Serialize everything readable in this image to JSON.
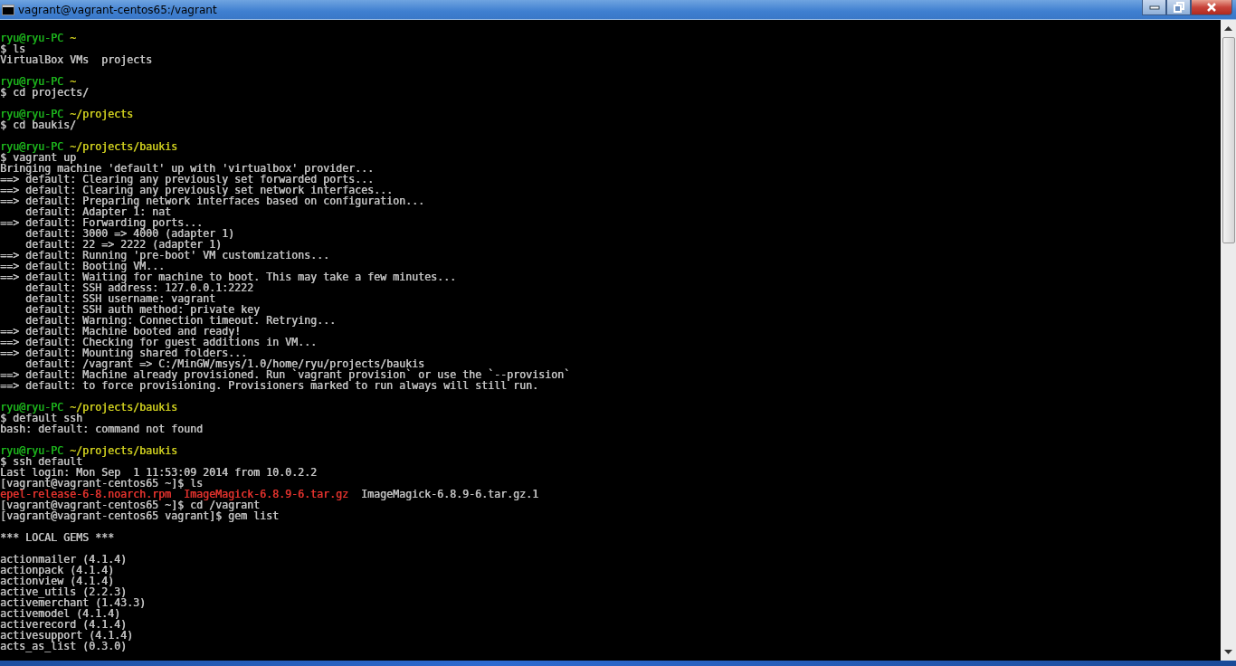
{
  "window": {
    "title": "vagrant@vagrant-centos65:/vagrant"
  },
  "terminal": {
    "lines": [
      {
        "kind": "blank"
      },
      {
        "kind": "text",
        "segments": [
          {
            "text": "ryu@ryu-PC",
            "color": "#1cb01c"
          },
          {
            "text": " ~",
            "color": "#c8c81e"
          }
        ]
      },
      {
        "kind": "text",
        "segments": [
          {
            "text": "$ ls",
            "color": "#c0c0c0"
          }
        ]
      },
      {
        "kind": "text",
        "segments": [
          {
            "text": "VirtualBox VMs  projects",
            "color": "#c0c0c0"
          }
        ]
      },
      {
        "kind": "blank"
      },
      {
        "kind": "text",
        "segments": [
          {
            "text": "ryu@ryu-PC",
            "color": "#1cb01c"
          },
          {
            "text": " ~",
            "color": "#c8c81e"
          }
        ]
      },
      {
        "kind": "text",
        "segments": [
          {
            "text": "$ cd projects/",
            "color": "#c0c0c0"
          }
        ]
      },
      {
        "kind": "blank"
      },
      {
        "kind": "text",
        "segments": [
          {
            "text": "ryu@ryu-PC",
            "color": "#1cb01c"
          },
          {
            "text": " ~/projects",
            "color": "#c8c81e"
          }
        ]
      },
      {
        "kind": "text",
        "segments": [
          {
            "text": "$ cd baukis/",
            "color": "#c0c0c0"
          }
        ]
      },
      {
        "kind": "blank"
      },
      {
        "kind": "text",
        "segments": [
          {
            "text": "ryu@ryu-PC",
            "color": "#1cb01c"
          },
          {
            "text": " ~/projects/baukis",
            "color": "#c8c81e"
          }
        ]
      },
      {
        "kind": "text",
        "segments": [
          {
            "text": "$ vagrant up",
            "color": "#c0c0c0"
          }
        ]
      },
      {
        "kind": "text",
        "segments": [
          {
            "text": "Bringing machine 'default' up with 'virtualbox' provider...",
            "color": "#c0c0c0"
          }
        ]
      },
      {
        "kind": "text",
        "segments": [
          {
            "text": "==> default: Clearing any previously set forwarded ports...",
            "color": "#c0c0c0"
          }
        ]
      },
      {
        "kind": "text",
        "segments": [
          {
            "text": "==> default: Clearing any previously set network interfaces...",
            "color": "#c0c0c0"
          }
        ]
      },
      {
        "kind": "text",
        "segments": [
          {
            "text": "==> default: Preparing network interfaces based on configuration...",
            "color": "#c0c0c0"
          }
        ]
      },
      {
        "kind": "text",
        "segments": [
          {
            "text": "    default: Adapter 1: nat",
            "color": "#c0c0c0"
          }
        ]
      },
      {
        "kind": "text",
        "segments": [
          {
            "text": "==> default: Forwarding ports...",
            "color": "#c0c0c0"
          }
        ]
      },
      {
        "kind": "text",
        "segments": [
          {
            "text": "    default: 3000 => 4000 (adapter 1)",
            "color": "#c0c0c0"
          }
        ]
      },
      {
        "kind": "text",
        "segments": [
          {
            "text": "    default: 22 => 2222 (adapter 1)",
            "color": "#c0c0c0"
          }
        ]
      },
      {
        "kind": "text",
        "segments": [
          {
            "text": "==> default: Running 'pre-boot' VM customizations...",
            "color": "#c0c0c0"
          }
        ]
      },
      {
        "kind": "text",
        "segments": [
          {
            "text": "==> default: Booting VM...",
            "color": "#c0c0c0"
          }
        ]
      },
      {
        "kind": "text",
        "segments": [
          {
            "text": "==> default: Waiting for machine to boot. This may take a few minutes...",
            "color": "#c0c0c0"
          }
        ]
      },
      {
        "kind": "text",
        "segments": [
          {
            "text": "    default: SSH address: 127.0.0.1:2222",
            "color": "#c0c0c0"
          }
        ]
      },
      {
        "kind": "text",
        "segments": [
          {
            "text": "    default: SSH username: vagrant",
            "color": "#c0c0c0"
          }
        ]
      },
      {
        "kind": "text",
        "segments": [
          {
            "text": "    default: SSH auth method: private key",
            "color": "#c0c0c0"
          }
        ]
      },
      {
        "kind": "text",
        "segments": [
          {
            "text": "    default: Warning: Connection timeout. Retrying...",
            "color": "#c0c0c0"
          }
        ]
      },
      {
        "kind": "text",
        "segments": [
          {
            "text": "==> default: Machine booted and ready!",
            "color": "#c0c0c0"
          }
        ]
      },
      {
        "kind": "text",
        "segments": [
          {
            "text": "==> default: Checking for guest additions in VM...",
            "color": "#c0c0c0"
          }
        ]
      },
      {
        "kind": "text",
        "segments": [
          {
            "text": "==> default: Mounting shared folders...",
            "color": "#c0c0c0"
          }
        ]
      },
      {
        "kind": "text",
        "segments": [
          {
            "text": "    default: /vagrant => C:/MinGW/msys/1.0/home/ryu/projects/baukis",
            "color": "#c0c0c0"
          }
        ]
      },
      {
        "kind": "text",
        "segments": [
          {
            "text": "==> default: Machine already provisioned. Run `vagrant provision` or use the `--provision`",
            "color": "#c0c0c0"
          }
        ]
      },
      {
        "kind": "text",
        "segments": [
          {
            "text": "==> default: to force provisioning. Provisioners marked to run always will still run.",
            "color": "#c0c0c0"
          }
        ]
      },
      {
        "kind": "blank"
      },
      {
        "kind": "text",
        "segments": [
          {
            "text": "ryu@ryu-PC",
            "color": "#1cb01c"
          },
          {
            "text": " ~/projects/baukis",
            "color": "#c8c81e"
          }
        ]
      },
      {
        "kind": "text",
        "segments": [
          {
            "text": "$ default ssh",
            "color": "#c0c0c0"
          }
        ]
      },
      {
        "kind": "text",
        "segments": [
          {
            "text": "bash: default: command not found",
            "color": "#c0c0c0"
          }
        ]
      },
      {
        "kind": "blank"
      },
      {
        "kind": "text",
        "segments": [
          {
            "text": "ryu@ryu-PC",
            "color": "#1cb01c"
          },
          {
            "text": " ~/projects/baukis",
            "color": "#c8c81e"
          }
        ]
      },
      {
        "kind": "text",
        "segments": [
          {
            "text": "$ ssh default",
            "color": "#c0c0c0"
          }
        ]
      },
      {
        "kind": "text",
        "segments": [
          {
            "text": "Last login: Mon Sep  1 11:53:09 2014 from 10.0.2.2",
            "color": "#c0c0c0"
          }
        ]
      },
      {
        "kind": "text",
        "segments": [
          {
            "text": "[vagrant@vagrant-centos65 ~]$ ls",
            "color": "#c0c0c0"
          }
        ]
      },
      {
        "kind": "text",
        "segments": [
          {
            "text": "epel-release-6-8.noarch.rpm",
            "color": "#e0322d"
          },
          {
            "text": "  ImageMagick-6.8.9-6.tar.gz",
            "color": "#e0322d"
          },
          {
            "text": "  ImageMagick-6.8.9-6.tar.gz.1",
            "color": "#c0c0c0"
          }
        ]
      },
      {
        "kind": "text",
        "segments": [
          {
            "text": "[vagrant@vagrant-centos65 ~]$ cd /vagrant",
            "color": "#c0c0c0"
          }
        ]
      },
      {
        "kind": "text",
        "segments": [
          {
            "text": "[vagrant@vagrant-centos65 vagrant]$ gem list",
            "color": "#c0c0c0"
          }
        ]
      },
      {
        "kind": "blank"
      },
      {
        "kind": "text",
        "segments": [
          {
            "text": "*** LOCAL GEMS ***",
            "color": "#c0c0c0"
          }
        ]
      },
      {
        "kind": "blank"
      },
      {
        "kind": "text",
        "segments": [
          {
            "text": "actionmailer (4.1.4)",
            "color": "#c0c0c0"
          }
        ]
      },
      {
        "kind": "text",
        "segments": [
          {
            "text": "actionpack (4.1.4)",
            "color": "#c0c0c0"
          }
        ]
      },
      {
        "kind": "text",
        "segments": [
          {
            "text": "actionview (4.1.4)",
            "color": "#c0c0c0"
          }
        ]
      },
      {
        "kind": "text",
        "segments": [
          {
            "text": "active_utils (2.2.3)",
            "color": "#c0c0c0"
          }
        ]
      },
      {
        "kind": "text",
        "segments": [
          {
            "text": "activemerchant (1.43.3)",
            "color": "#c0c0c0"
          }
        ]
      },
      {
        "kind": "text",
        "segments": [
          {
            "text": "activemodel (4.1.4)",
            "color": "#c0c0c0"
          }
        ]
      },
      {
        "kind": "text",
        "segments": [
          {
            "text": "activerecord (4.1.4)",
            "color": "#c0c0c0"
          }
        ]
      },
      {
        "kind": "text",
        "segments": [
          {
            "text": "activesupport (4.1.4)",
            "color": "#c0c0c0"
          }
        ]
      },
      {
        "kind": "text",
        "segments": [
          {
            "text": "acts_as_list (0.3.0)",
            "color": "#c0c0c0"
          }
        ]
      }
    ]
  }
}
